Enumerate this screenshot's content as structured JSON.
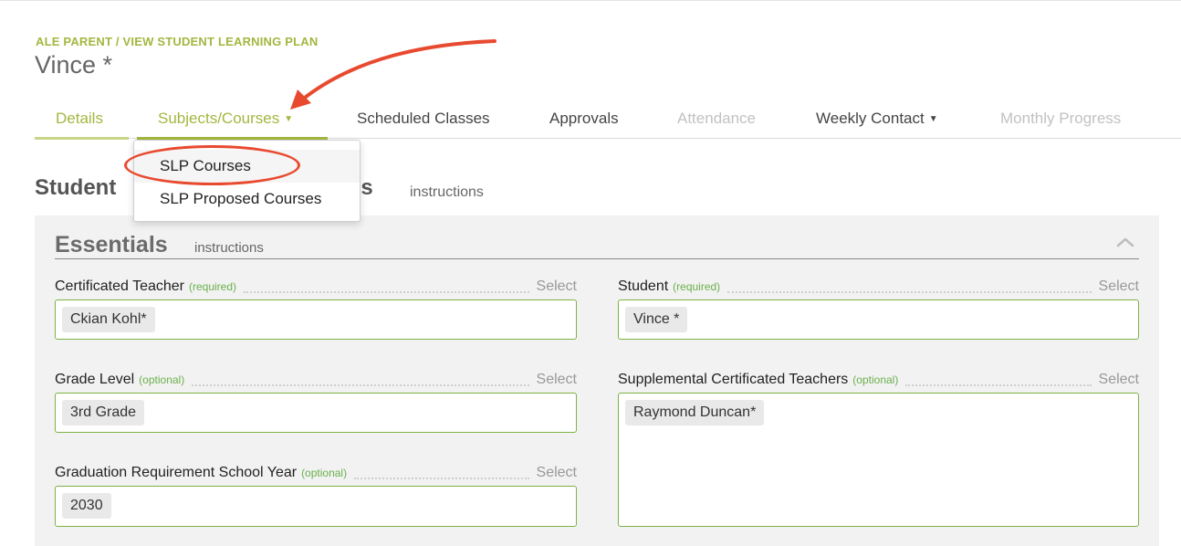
{
  "colors": {
    "accent_green": "#a3b740",
    "field_green": "#7cb342",
    "optional_green": "#6ab04c",
    "annotation_red": "#e84a2f"
  },
  "breadcrumb": "ALE PARENT / VIEW STUDENT LEARNING PLAN",
  "page_title": "Vince *",
  "tabs": [
    {
      "label": "Details",
      "state": "active"
    },
    {
      "label": "Subjects/Courses",
      "state": "open",
      "has_caret": true
    },
    {
      "label": "Scheduled Classes",
      "state": "normal"
    },
    {
      "label": "Approvals",
      "state": "normal"
    },
    {
      "label": "Attendance",
      "state": "disabled"
    },
    {
      "label": "Weekly Contact",
      "state": "normal",
      "has_caret": true
    },
    {
      "label": "Monthly Progress",
      "state": "disabled"
    }
  ],
  "dropdown": {
    "items": [
      "SLP Courses",
      "SLP Proposed Courses"
    ],
    "highlighted": "SLP Courses"
  },
  "section": {
    "title_start": "Student",
    "title_end": "ils",
    "instructions": "instructions"
  },
  "essentials": {
    "title": "Essentials",
    "instructions": "instructions",
    "collapse_icon": "chevron-up-icon"
  },
  "fields": {
    "certificated_teacher": {
      "label": "Certificated Teacher",
      "qualifier": "(required)",
      "action": "Select",
      "values": [
        "Ckian Kohl*"
      ]
    },
    "student": {
      "label": "Student",
      "qualifier": "(required)",
      "action": "Select",
      "values": [
        "Vince *"
      ]
    },
    "grade_level": {
      "label": "Grade Level",
      "qualifier": "(optional)",
      "action": "Select",
      "values": [
        "3rd Grade"
      ]
    },
    "supplemental_teachers": {
      "label": "Supplemental Certificated Teachers",
      "qualifier": "(optional)",
      "action": "Select",
      "values": [
        "Raymond Duncan*"
      ]
    },
    "graduation_year": {
      "label": "Graduation Requirement School Year",
      "qualifier": "(optional)",
      "action": "Select",
      "values": [
        "2030"
      ]
    }
  }
}
